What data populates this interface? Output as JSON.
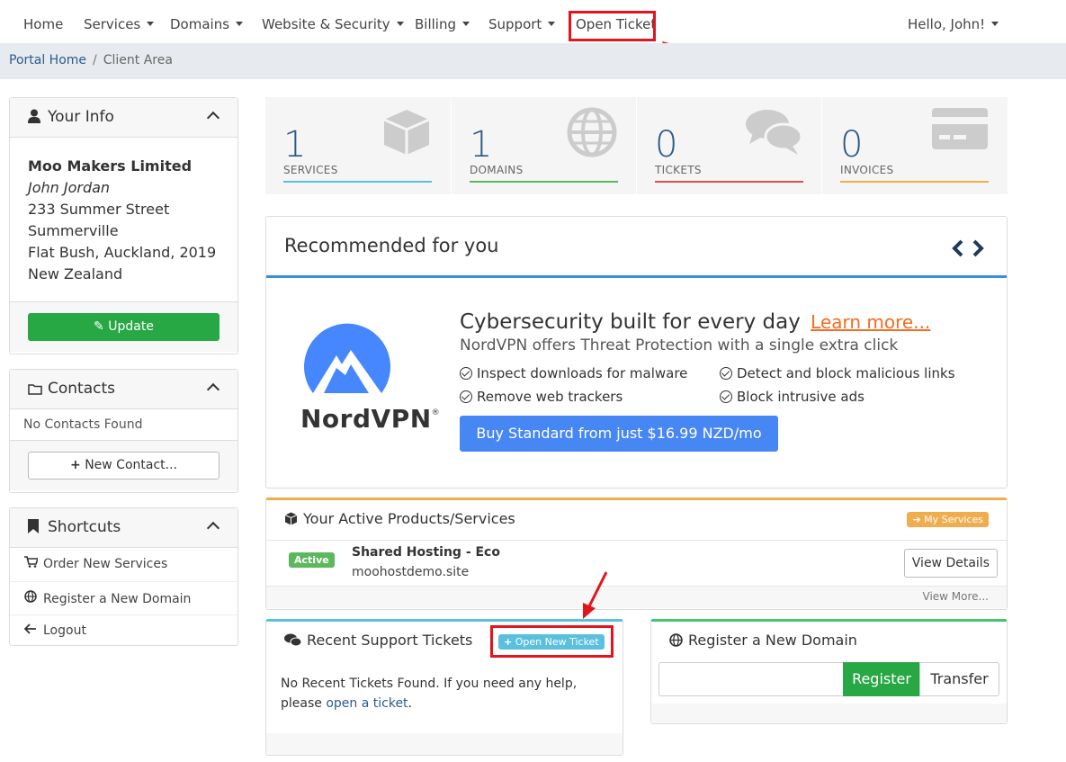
{
  "nav": {
    "home": "Home",
    "services": "Services",
    "domains": "Domains",
    "website_security": "Website & Security",
    "billing": "Billing",
    "support": "Support",
    "open_ticket": "Open Ticket",
    "user": "Hello, John!"
  },
  "breadcrumb": {
    "home": "Portal Home",
    "separator": "/",
    "current": "Client Area"
  },
  "your_info": {
    "title": "Your Info",
    "company": "Moo Makers Limited",
    "name": "John Jordan",
    "address1": "233 Summer Street",
    "address2": "Summerville",
    "city_line": "Flat Bush, Auckland, 2019",
    "country": "New Zealand",
    "update_label": "Update"
  },
  "contacts": {
    "title": "Contacts",
    "empty": "No Contacts Found",
    "new_label": "New Contact..."
  },
  "shortcuts": {
    "title": "Shortcuts",
    "items": [
      "Order New Services",
      "Register a New Domain",
      "Logout"
    ]
  },
  "stats": [
    {
      "value": "1",
      "label": "SERVICES",
      "color": "#5bc0de"
    },
    {
      "value": "1",
      "label": "DOMAINS",
      "color": "#5cb85c"
    },
    {
      "value": "0",
      "label": "TICKETS",
      "color": "#d9534f"
    },
    {
      "value": "0",
      "label": "INVOICES",
      "color": "#f0ad4e"
    }
  ],
  "recommended": {
    "title": "Recommended for you",
    "headline": "Cybersecurity built for every day",
    "learn_more": "Learn more...",
    "subline": "NordVPN offers Threat Protection with a single extra click",
    "features": [
      "Inspect downloads for malware",
      "Detect and block malicious links",
      "Remove web trackers",
      "Block intrusive ads"
    ],
    "buy_label": "Buy Standard from just $16.99 NZD/mo",
    "brand": "NordVPN",
    "brand_mark": "®"
  },
  "products": {
    "title": "Your Active Products/Services",
    "my_services": "My Services",
    "status": "Active",
    "name": "Shared Hosting - Eco",
    "domain": "moohostdemo.site",
    "view_details": "View Details",
    "view_more": "View More..."
  },
  "tickets": {
    "title": "Recent Support Tickets",
    "open_new": "Open New Ticket",
    "empty_text": "No Recent Tickets Found. If you need any help, please",
    "link_text": "open a ticket",
    "period": "."
  },
  "register_domain": {
    "title": "Register a New Domain",
    "input_value": "",
    "register_label": "Register",
    "transfer_label": "Transfer"
  },
  "colors": {
    "accent_blue": "#2b5a86",
    "green": "#28a745",
    "annotation_red": "#e3141b",
    "promo_blue": "#4787f3"
  }
}
